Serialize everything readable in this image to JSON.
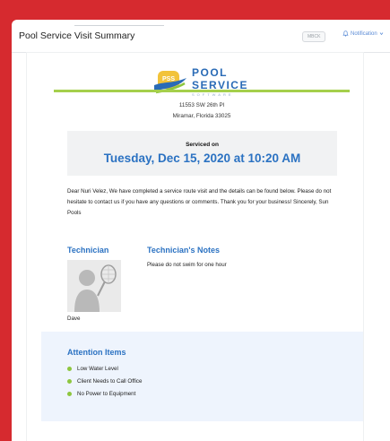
{
  "header": {
    "title": "Pool Service Visit Summary",
    "badge": "MBCK",
    "notification_label": "Notification"
  },
  "logo": {
    "brand": "POOL SERVICE",
    "sub": "SOFTWARE",
    "mark_text": "PSS"
  },
  "address": {
    "line1": "11553 SW 26th Pl",
    "line2": "Miramar, Florida 33025"
  },
  "service": {
    "label": "Serviced on",
    "datetime": "Tuesday, Dec 15, 2020 at 10:20 AM"
  },
  "letter": {
    "body": "Dear Nuri Velez, We have completed a service route visit and the details can be found below. Please do not hesitate to contact us if you have any questions or comments. Thank you for your business! Sincerely, Sun Pools"
  },
  "technician": {
    "heading": "Technician",
    "name": "Dave"
  },
  "notes": {
    "heading": "Technician's Notes",
    "text": "Please do not swim for one hour"
  },
  "attention": {
    "heading": "Attention Items",
    "items": [
      "Low Water Level",
      "Client Needs to Call Office",
      "No Power to Equipment"
    ]
  },
  "colors": {
    "accent_blue": "#2b72c2",
    "rule_green": "#a5cf4c",
    "bullet_green": "#8dc63f",
    "frame_red": "#d62a2f"
  }
}
